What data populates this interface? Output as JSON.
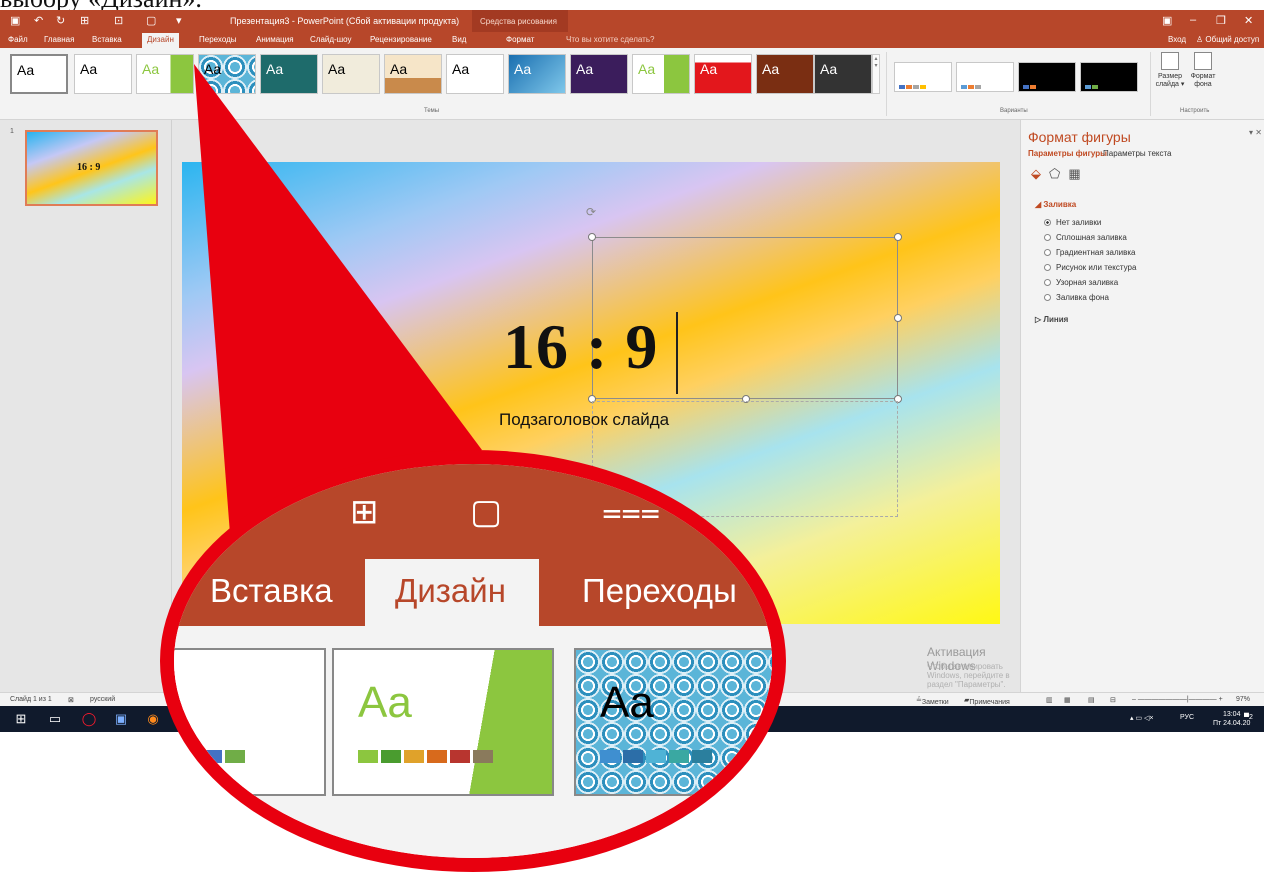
{
  "doc": {
    "text": "выбору «Дизайн»."
  },
  "window": {
    "title": "Презентация3 - PowerPoint (Сбой активации продукта)",
    "context_group": "Средства рисования",
    "tabs": [
      "Файл",
      "Главная",
      "Вставка",
      "Дизайн",
      "Переходы",
      "Анимация",
      "Слайд-шоу",
      "Рецензирование",
      "Вид",
      "Формат"
    ],
    "active_tab": "Дизайн",
    "tell_me": "Что вы хотите сделать?",
    "sign_in": "Вход",
    "share": "Общий доступ"
  },
  "ribbon": {
    "themes_label": "Темы",
    "variants_label": "Варианты",
    "customize_label": "Настроить",
    "theme_sample": "Aa",
    "slide_size": "Размер слайда ▾",
    "format_background": "Формат фона"
  },
  "slide": {
    "number": "1",
    "title": "16 : 9",
    "subtitle": "Подзаголовок слайда"
  },
  "format_pane": {
    "title": "Формат фигуры",
    "tab_shape": "Параметры фигуры",
    "tab_text": "Параметры текста",
    "fill_header": "Заливка",
    "fill_options": [
      "Нет заливки",
      "Сплошная заливка",
      "Градиентная заливка",
      "Рисунок или текстура",
      "Узорная заливка",
      "Заливка фона"
    ],
    "line_header": "Линия"
  },
  "activation": {
    "title": "Активация Windows",
    "message": "Чтобы активировать Windows, перейдите в раздел \"Параметры\"."
  },
  "status": {
    "slide_info": "Слайд 1 из 1",
    "language": "русский",
    "notes": "Заметки",
    "comments": "Примечания",
    "zoom": "97%"
  },
  "taskbar": {
    "lang": "РУС",
    "time": "13:04",
    "date": "Пт 24.04.20",
    "notif_count": "2"
  },
  "zoom_callout": {
    "tabs": [
      "Вставка",
      "Дизайн",
      "Переходы"
    ],
    "theme_sample": "Aa"
  },
  "colors": {
    "accent": "#b7472a",
    "callout_red": "#e8000f"
  }
}
